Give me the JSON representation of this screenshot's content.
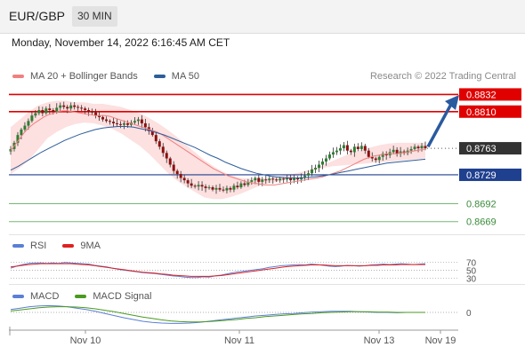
{
  "header": {
    "symbol": "EUR/GBP",
    "timeframe": "30 MIN"
  },
  "datetime": "Monday, November 14, 2022 6:16:45 AM CET",
  "copyright": "Research © 2022 Trading Central",
  "legends": {
    "main": [
      {
        "label": "MA 20 + Bollinger Bands",
        "color": "#f08080"
      },
      {
        "label": "MA 50",
        "color": "#2e5d9a"
      }
    ],
    "rsi": [
      {
        "label": "RSI",
        "color": "#5b7fd6"
      },
      {
        "label": "9MA",
        "color": "#e02020"
      }
    ],
    "macd": [
      {
        "label": "MACD",
        "color": "#5b7fd6"
      },
      {
        "label": "MACD Signal",
        "color": "#4a9a20"
      }
    ]
  },
  "colors": {
    "resistance": "#e00000",
    "pivot": "#1f3f8f",
    "support": "#77b877",
    "current": "#333333",
    "arrow": "#2a5a9f",
    "bull": "#2e7d32",
    "bear": "#8b1010"
  },
  "chart_data": [
    {
      "type": "candlestick",
      "panel": "price",
      "x_ticks": [
        "Nov 10",
        "Nov 11",
        "Nov 13",
        "Nov 19"
      ],
      "ylim": [
        0.8655,
        0.8845
      ],
      "levels": [
        {
          "value": 0.8832,
          "label": "0.8832",
          "kind": "resistance"
        },
        {
          "value": 0.881,
          "label": "0.8810",
          "kind": "resistance"
        },
        {
          "value": 0.8763,
          "label": "0.8763",
          "kind": "current"
        },
        {
          "value": 0.8729,
          "label": "0.8729",
          "kind": "pivot"
        },
        {
          "value": 0.8692,
          "label": "0.8692",
          "kind": "support"
        },
        {
          "value": 0.8669,
          "label": "0.8669",
          "kind": "support"
        }
      ],
      "close": [
        0.8762,
        0.877,
        0.878,
        0.8787,
        0.8792,
        0.8798,
        0.8805,
        0.8808,
        0.8812,
        0.8808,
        0.8814,
        0.8812,
        0.881,
        0.8815,
        0.8818,
        0.8816,
        0.8814,
        0.8818,
        0.8816,
        0.8815,
        0.8814,
        0.8812,
        0.881,
        0.8809,
        0.8805,
        0.8803,
        0.88,
        0.8798,
        0.8797,
        0.8795,
        0.8794,
        0.8793,
        0.8795,
        0.8793,
        0.8796,
        0.8798,
        0.88,
        0.8795,
        0.879,
        0.8785,
        0.878,
        0.8772,
        0.8765,
        0.8757,
        0.875,
        0.8742,
        0.8734,
        0.873,
        0.8725,
        0.8722,
        0.8718,
        0.8715,
        0.8714,
        0.8716,
        0.8714,
        0.8712,
        0.8713,
        0.871,
        0.8712,
        0.871,
        0.8709,
        0.8712,
        0.871,
        0.8715,
        0.8713,
        0.8718,
        0.8716,
        0.872,
        0.8722,
        0.8725,
        0.872,
        0.8723,
        0.8722,
        0.8724,
        0.8723,
        0.8722,
        0.8724,
        0.8723,
        0.8725,
        0.8722,
        0.8725,
        0.8723,
        0.8726,
        0.8728,
        0.8731,
        0.8736,
        0.8738,
        0.8742,
        0.8746,
        0.875,
        0.8755,
        0.8758,
        0.876,
        0.8763,
        0.8767,
        0.876,
        0.8758,
        0.8765,
        0.8762,
        0.8766,
        0.876,
        0.8752,
        0.875,
        0.8748,
        0.8752,
        0.8756,
        0.8754,
        0.8758,
        0.8761,
        0.8756,
        0.8759,
        0.8757,
        0.876,
        0.8762,
        0.8765,
        0.8763,
        0.8766,
        0.8763
      ],
      "ma20": [
        0.876,
        0.8768,
        0.8776,
        0.8784,
        0.879,
        0.8795,
        0.8799,
        0.8803,
        0.8806,
        0.8808,
        0.881,
        0.8811,
        0.8811,
        0.881,
        0.8809,
        0.8808,
        0.8807,
        0.8806,
        0.8805,
        0.8805,
        0.8805,
        0.8804,
        0.8802,
        0.88,
        0.8798,
        0.8796,
        0.8794,
        0.8792,
        0.879,
        0.8788,
        0.8786,
        0.8784,
        0.8781,
        0.8777,
        0.8773,
        0.8769,
        0.8765,
        0.8761,
        0.8757,
        0.8753,
        0.8749,
        0.8745,
        0.8741,
        0.8737,
        0.8734,
        0.8731,
        0.8728,
        0.8726,
        0.8724,
        0.8722,
        0.872,
        0.8719,
        0.8718,
        0.8717,
        0.8716,
        0.8716,
        0.8716,
        0.8717,
        0.8718,
        0.8719,
        0.872,
        0.8721,
        0.8722,
        0.8723,
        0.8724,
        0.8725,
        0.8726,
        0.8728,
        0.873,
        0.8732,
        0.8734,
        0.8737,
        0.874,
        0.8743,
        0.8746,
        0.8749,
        0.8751,
        0.8753,
        0.8754,
        0.8755,
        0.8756,
        0.8756,
        0.8756,
        0.8757,
        0.8758,
        0.8759,
        0.876,
        0.8761,
        0.8762
      ],
      "ma50": [
        0.8735,
        0.874,
        0.8746,
        0.8752,
        0.8758,
        0.8763,
        0.8768,
        0.8773,
        0.8777,
        0.8781,
        0.8784,
        0.8787,
        0.8789,
        0.879,
        0.8791,
        0.8791,
        0.879,
        0.8788,
        0.8786,
        0.8783,
        0.878,
        0.8776,
        0.8772,
        0.8768,
        0.8764,
        0.8759,
        0.8754,
        0.875,
        0.8745,
        0.8741,
        0.8737,
        0.8734,
        0.8731,
        0.8729,
        0.8727,
        0.8726,
        0.8725,
        0.8725,
        0.8725,
        0.8726,
        0.8727,
        0.8728,
        0.873,
        0.8732,
        0.8734,
        0.8736,
        0.8738,
        0.874,
        0.8742,
        0.8744,
        0.8745,
        0.8746,
        0.8747,
        0.8748,
        0.8749
      ],
      "bb_upper": [
        0.879,
        0.88,
        0.881,
        0.8818,
        0.8822,
        0.8824,
        0.8824,
        0.8822,
        0.8822,
        0.882,
        0.882,
        0.8818,
        0.8816,
        0.8812,
        0.8808,
        0.8802,
        0.8795,
        0.8787,
        0.8778,
        0.8768,
        0.8758,
        0.8748,
        0.874,
        0.8733,
        0.8728,
        0.8725,
        0.8724,
        0.8724,
        0.8725,
        0.8727,
        0.8729,
        0.8731,
        0.8734,
        0.8737,
        0.8742,
        0.8747,
        0.8752,
        0.8757,
        0.8761,
        0.8764,
        0.8767,
        0.8769,
        0.877,
        0.877,
        0.877,
        0.877
      ],
      "bb_lower": [
        0.873,
        0.8738,
        0.8748,
        0.8762,
        0.8776,
        0.8784,
        0.879,
        0.8794,
        0.8796,
        0.8795,
        0.8792,
        0.8788,
        0.8782,
        0.8774,
        0.8766,
        0.8756,
        0.8744,
        0.8732,
        0.8722,
        0.8714,
        0.8707,
        0.87,
        0.8698,
        0.8698,
        0.8701,
        0.8705,
        0.871,
        0.8715,
        0.8718,
        0.872,
        0.8723,
        0.8727,
        0.8731,
        0.8735,
        0.8738,
        0.874,
        0.8741,
        0.8742,
        0.8743,
        0.8744,
        0.8745,
        0.8746,
        0.8747,
        0.8748,
        0.8749,
        0.875
      ]
    },
    {
      "type": "line",
      "panel": "rsi",
      "ylim": [
        25,
        75
      ],
      "y_ticks": [
        "70",
        "50",
        "30"
      ],
      "series": [
        {
          "name": "RSI",
          "values": [
            55,
            60,
            64,
            67,
            68,
            68,
            67,
            68,
            67,
            69,
            68,
            67,
            66,
            65,
            62,
            60,
            58,
            55,
            52,
            50,
            48,
            46,
            44,
            43,
            42,
            40,
            38,
            36,
            35,
            33,
            32,
            32,
            34,
            33,
            36,
            38,
            41,
            44,
            46,
            48,
            50,
            52,
            54,
            57,
            59,
            61,
            62,
            63,
            64,
            63,
            65,
            64,
            62,
            60,
            59,
            60,
            62,
            61,
            60,
            61,
            63,
            64,
            65,
            64,
            65,
            66,
            65,
            64,
            65,
            66
          ]
        },
        {
          "name": "9MA",
          "values": [
            58,
            60,
            62,
            64,
            65,
            66,
            66,
            66,
            66,
            66,
            66,
            65,
            64,
            63,
            61,
            59,
            57,
            55,
            53,
            51,
            49,
            47,
            45,
            44,
            43,
            41,
            40,
            38,
            37,
            36,
            35,
            35,
            35,
            35,
            36,
            37,
            39,
            41,
            43,
            45,
            47,
            49,
            51,
            53,
            55,
            57,
            59,
            60,
            61,
            62,
            63,
            63,
            63,
            62,
            61,
            61,
            61,
            61,
            61,
            61,
            62,
            62,
            63,
            63,
            63,
            64,
            64,
            64,
            64,
            64
          ]
        }
      ]
    },
    {
      "type": "line",
      "panel": "macd",
      "ylim": [
        -0.004,
        0.003
      ],
      "y_ticks": [
        "0"
      ],
      "series": [
        {
          "name": "MACD",
          "values": [
            0.0008,
            0.0012,
            0.0016,
            0.0018,
            0.0019,
            0.0018,
            0.0016,
            0.0012,
            0.0008,
            0.0003,
            -0.0003,
            -0.0009,
            -0.0015,
            -0.002,
            -0.0025,
            -0.0028,
            -0.003,
            -0.0031,
            -0.0031,
            -0.003,
            -0.0028,
            -0.0025,
            -0.0022,
            -0.0019,
            -0.0016,
            -0.0013,
            -0.001,
            -0.0008,
            -0.0006,
            -0.0004,
            -0.0003,
            -0.0001,
            0.0001,
            0.0002,
            0.0003,
            0.0003,
            0.0003,
            0.0002,
            0.0001,
            0.0,
            0.0,
            -0.0001,
            0.0,
            0.0,
            0.0
          ]
        },
        {
          "name": "MACD Signal",
          "values": [
            0.0004,
            0.0007,
            0.001,
            0.0013,
            0.0015,
            0.0016,
            0.0016,
            0.0015,
            0.0013,
            0.001,
            0.0006,
            0.0002,
            -0.0003,
            -0.0008,
            -0.0013,
            -0.0017,
            -0.0021,
            -0.0024,
            -0.0026,
            -0.0027,
            -0.0027,
            -0.0026,
            -0.0024,
            -0.0022,
            -0.002,
            -0.0017,
            -0.0015,
            -0.0012,
            -0.001,
            -0.0008,
            -0.0006,
            -0.0004,
            -0.0003,
            -0.0001,
            0.0,
            0.0001,
            0.0002,
            0.0002,
            0.0002,
            0.0001,
            0.0001,
            0.0,
            0.0,
            0.0,
            0.0
          ]
        }
      ]
    }
  ]
}
